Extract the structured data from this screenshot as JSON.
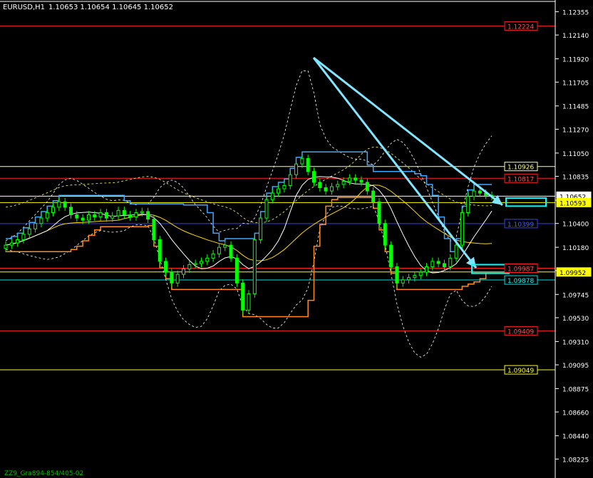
{
  "header": {
    "symbol_label": "EURUSD,H1",
    "ohlc": "1.10653 1.10654 1.10645 1.10652"
  },
  "footer": {
    "indicator_text": "ZZ9_Gra894-854/405-02"
  },
  "colors": {
    "background": "#000000",
    "candle": "#00ff00",
    "axis_text": "#ffffff",
    "red_level": "#ff2020",
    "yellow_level": "#ffff00",
    "blue_level": "#3040ff",
    "cyan_box": "#00ffff",
    "arrow": "#7fe6ff",
    "orange_channel": "#ff8c1a",
    "blue_channel": "#40a8ff",
    "bb_dashed": "#ffffff",
    "ma_yellow": "#ffd700"
  },
  "chart_data": {
    "type": "candlestick",
    "ylim": [
      1.0805,
      1.1245
    ],
    "price_ticks": [
      "1.12355",
      "1.12140",
      "1.11920",
      "1.11705",
      "1.11485",
      "1.11270",
      "1.11050",
      "1.10835",
      "1.10615",
      "1.10400",
      "1.10180",
      "1.09965",
      "1.09745",
      "1.09530",
      "1.09310",
      "1.09095",
      "1.08875",
      "1.08660",
      "1.08440",
      "1.08225",
      "1.08005"
    ],
    "levels": [
      {
        "price": 1.12224,
        "label": "1.12224",
        "color": "#ff2020",
        "text": "#ff5050",
        "fill": "#000000"
      },
      {
        "price": 1.10926,
        "label": "1.10926",
        "color": "#ffff99",
        "text": "#ffff66",
        "fill": "#000000"
      },
      {
        "price": 1.10817,
        "label": "1.10817",
        "color": "#ff2020",
        "text": "#ff5050",
        "fill": "#000000"
      },
      {
        "price": 1.10652,
        "label": "1.10652",
        "color": "#ffffff",
        "text": "#000000",
        "fill": "#ffffff"
      },
      {
        "price": 1.10593,
        "label": "1.10593",
        "color": "#ffff00",
        "text": "#000000",
        "fill": "#ffff00"
      },
      {
        "price": 1.10399,
        "label": "1.10399",
        "color": "#3040ff",
        "text": "#4060ff",
        "fill": "#000000"
      },
      {
        "price": 1.09987,
        "label": "1.09987",
        "color": "#ff2020",
        "text": "#ff5050",
        "fill": "#000000"
      },
      {
        "price": 1.09952,
        "label": "1.09952",
        "color": "#ffff00",
        "text": "#000000",
        "fill": "#ffff00"
      },
      {
        "price": 1.09878,
        "label": "1.09878",
        "color": "#00e0e0",
        "text": "#00ffff",
        "fill": "#000000"
      },
      {
        "price": 1.09409,
        "label": "1.09409",
        "color": "#ff2020",
        "text": "#ff5050",
        "fill": "#000000"
      },
      {
        "price": 1.09049,
        "label": "1.09049",
        "color": "#ffff00",
        "text": "#ffff00",
        "fill": "#000000"
      }
    ],
    "closes": [
      1.102,
      1.1022,
      1.1025,
      1.103,
      1.1035,
      1.104,
      1.1045,
      1.105,
      1.1055,
      1.106,
      1.1055,
      1.1048,
      1.1045,
      1.1043,
      1.1048,
      1.1046,
      1.105,
      1.1045,
      1.1047,
      1.1052,
      1.1048,
      1.1046,
      1.105,
      1.1051,
      1.1044,
      1.1025,
      1.1005,
      1.0995,
      1.0985,
      1.0993,
      1.0998,
      1.1002,
      1.1003,
      1.1005,
      1.1008,
      1.1012,
      1.1018,
      1.102,
      1.1008,
      1.0985,
      1.096,
      1.0975,
      1.1025,
      1.1045,
      1.1062,
      1.1068,
      1.1072,
      1.1075,
      1.1085,
      1.1095,
      1.11,
      1.1088,
      1.1078,
      1.1073,
      1.107,
      1.1074,
      1.1076,
      1.1079,
      1.1082,
      1.108,
      1.1078,
      1.107,
      1.106,
      1.104,
      1.102,
      1.1,
      1.0985,
      1.0988,
      1.099,
      1.0992,
      1.0995,
      1.1,
      1.1005,
      1.1003,
      1.1,
      1.1008,
      1.102,
      1.105,
      1.1065,
      1.107,
      1.1068,
      1.1066,
      1.1065
    ],
    "zigzag_arrows": [
      {
        "from": [
          440,
          1.1193
        ],
        "to": [
          705,
          1.1057
        ]
      },
      {
        "from": [
          440,
          1.1193
        ],
        "to": [
          668,
          1.0999
        ]
      }
    ],
    "target_boxes": [
      {
        "x": [
          710,
          766
        ],
        "price_range": [
          1.1056,
          1.10635
        ]
      },
      {
        "x": [
          662,
          714
        ],
        "price_range": [
          1.0994,
          1.1002
        ]
      }
    ]
  }
}
